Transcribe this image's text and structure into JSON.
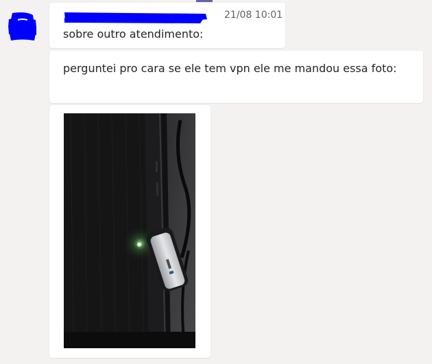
{
  "conversation": {
    "messages": [
      {
        "sender_name": "",
        "timestamp": "21/08 10:01",
        "text": "sobre outro atendimento:"
      },
      {
        "text": "perguntei pro cara se ele tem vpn ele me mandou essa foto:"
      },
      {
        "attachment_type": "photo"
      }
    ]
  },
  "colors": {
    "background": "#f3f2f1",
    "bubble": "#ffffff",
    "redaction": "#0000ff",
    "timestamp": "#605e5c",
    "accent": "#6264a7"
  }
}
